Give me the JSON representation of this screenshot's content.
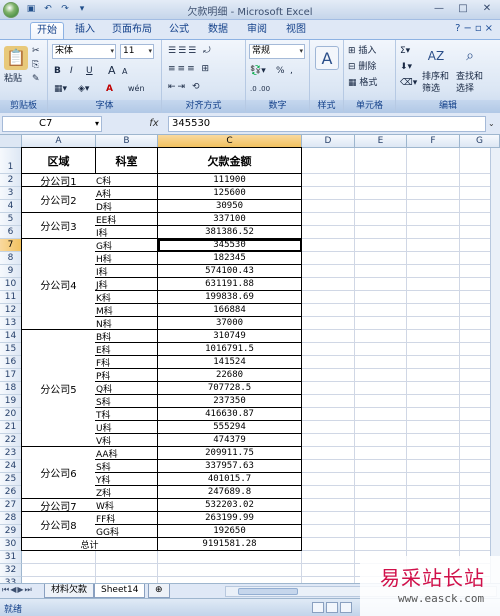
{
  "window": {
    "title": "欠款明细 - Microsoft Excel",
    "qat_icons": [
      "save-icon",
      "undo-icon",
      "redo-icon",
      "customize-icon"
    ],
    "controls": [
      "minimize-icon",
      "maximize-icon",
      "close-icon"
    ]
  },
  "ribbon_tabs": [
    "开始",
    "插入",
    "页面布局",
    "公式",
    "数据",
    "审阅",
    "视图"
  ],
  "active_tab": "开始",
  "ribbon": {
    "clipboard": {
      "paste": "粘贴",
      "label": "剪贴板"
    },
    "font": {
      "name": "宋体",
      "size": "11",
      "bold": "B",
      "italic": "I",
      "underline": "U",
      "grow": "A",
      "shrink": "A",
      "fill": "A",
      "wen": "wén",
      "label": "字体"
    },
    "alignment": {
      "label": "对齐方式"
    },
    "number": {
      "format": "常规",
      "percent": "%",
      "comma": ",",
      "label": "数字"
    },
    "styles": {
      "label": "样式"
    },
    "cells": {
      "insert": "插入",
      "delete": "删除",
      "format": "格式",
      "label": "单元格"
    },
    "editing": {
      "sort": "排序和",
      "sort2": "筛选",
      "find": "查找和",
      "find2": "选择",
      "label": "编辑"
    }
  },
  "formula_bar": {
    "name_box": "C7",
    "fx": "fx",
    "value": "345530"
  },
  "columns": [
    "A",
    "B",
    "C",
    "D",
    "E",
    "F",
    "G"
  ],
  "rows": [
    "1",
    "2",
    "3",
    "4",
    "5",
    "6",
    "7",
    "8",
    "9",
    "10",
    "11",
    "12",
    "13",
    "14",
    "15",
    "16",
    "17",
    "18",
    "19",
    "20",
    "21",
    "22",
    "23",
    "24",
    "25",
    "26",
    "27",
    "28",
    "29",
    "30",
    "31",
    "32",
    "33"
  ],
  "headers": {
    "a": "区域",
    "b": "科室",
    "c": "欠款金额"
  },
  "table": [
    {
      "b": "C科",
      "c": "111900"
    },
    {
      "b": "A科",
      "c": "125600"
    },
    {
      "b": "D科",
      "c": "30950"
    },
    {
      "b": "EE科",
      "c": "337100"
    },
    {
      "b": "I科",
      "c": "381386.52"
    },
    {
      "b": "G科",
      "c": "345530"
    },
    {
      "b": "H科",
      "c": "182345"
    },
    {
      "b": "I科",
      "c": "574100.43"
    },
    {
      "b": "J科",
      "c": "631191.88"
    },
    {
      "b": "K科",
      "c": "199838.69"
    },
    {
      "b": "M科",
      "c": "166884"
    },
    {
      "b": "N科",
      "c": "37000"
    },
    {
      "b": "B科",
      "c": "310749"
    },
    {
      "b": "E科",
      "c": "1016791.5"
    },
    {
      "b": "F科",
      "c": "141524"
    },
    {
      "b": "P科",
      "c": "22680"
    },
    {
      "b": "Q科",
      "c": "707728.5"
    },
    {
      "b": "S科",
      "c": "237350"
    },
    {
      "b": "T科",
      "c": "416630.87"
    },
    {
      "b": "U科",
      "c": "555294"
    },
    {
      "b": "V科",
      "c": "474379"
    },
    {
      "b": "AA科",
      "c": "209911.75"
    },
    {
      "b": "S科",
      "c": "337957.63"
    },
    {
      "b": "Y科",
      "c": "401015.7"
    },
    {
      "b": "Z科",
      "c": "247689.8"
    },
    {
      "b": "W科",
      "c": "532203.02"
    },
    {
      "b": "FF科",
      "c": "263199.99"
    },
    {
      "b": "GG科",
      "c": "192650"
    }
  ],
  "regions": [
    {
      "name": "分公司1"
    },
    {
      "name": "分公司2"
    },
    {
      "name": "分公司3"
    },
    {
      "name": "分公司4"
    },
    {
      "name": "分公司5"
    },
    {
      "name": "分公司6"
    },
    {
      "name": "分公司7"
    },
    {
      "name": "分公司8"
    }
  ],
  "total": {
    "label": "总计",
    "value": "9191581.28"
  },
  "sheet_tabs": [
    "材料欠款",
    "Sheet14"
  ],
  "active_sheet": "Sheet14",
  "status": {
    "ready": "就绪"
  },
  "watermark": {
    "text": "易采站长站",
    "url": "www.easck.com"
  }
}
